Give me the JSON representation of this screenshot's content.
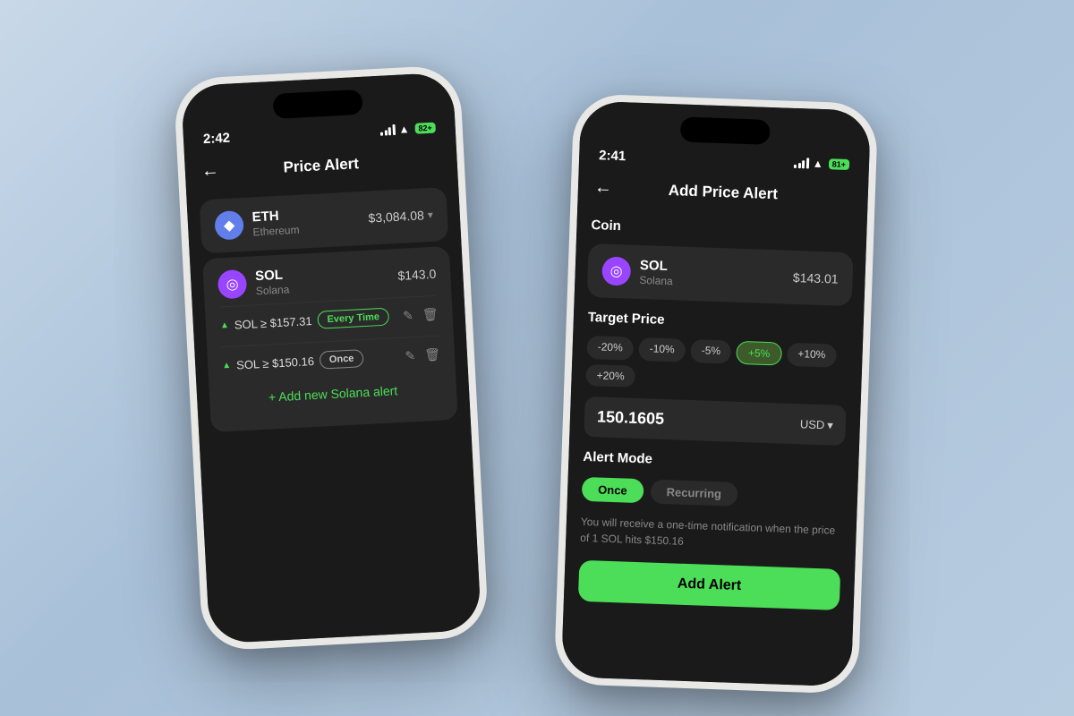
{
  "phone1": {
    "time": "2:42",
    "battery": "82+",
    "title": "Price Alert",
    "back_label": "←",
    "eth": {
      "symbol": "ETH",
      "name": "Ethereum",
      "price": "$3,084.08",
      "icon": "◆"
    },
    "sol": {
      "symbol": "SOL",
      "name": "Solana",
      "price": "$143.0",
      "icon": "◎"
    },
    "alerts": [
      {
        "condition": "SOL ≥ $157.31",
        "badge": "Every Time",
        "badge_type": "everytime"
      },
      {
        "condition": "SOL ≥ $150.16",
        "badge": "Once",
        "badge_type": "once"
      }
    ],
    "add_alert_label": "+ Add new Solana alert"
  },
  "phone2": {
    "time": "2:41",
    "battery": "81+",
    "title": "Add Price Alert",
    "back_label": "←",
    "coin_label": "Coin",
    "sol": {
      "symbol": "SOL",
      "name": "Solana",
      "price": "$143.01",
      "icon": "◎"
    },
    "target_price_label": "Target Price",
    "chips": [
      "-20%",
      "-10%",
      "-5%",
      "+5%",
      "+10%",
      "+20%"
    ],
    "active_chip": "+5%",
    "price_value": "150.1605",
    "currency": "USD",
    "alert_mode_label": "Alert Mode",
    "modes": [
      "Once",
      "Recurring"
    ],
    "active_mode": "Once",
    "alert_desc": "You will receive a one-time notification when the price of 1 SOL hits $150.16",
    "confirm_label": "Add Alert"
  }
}
